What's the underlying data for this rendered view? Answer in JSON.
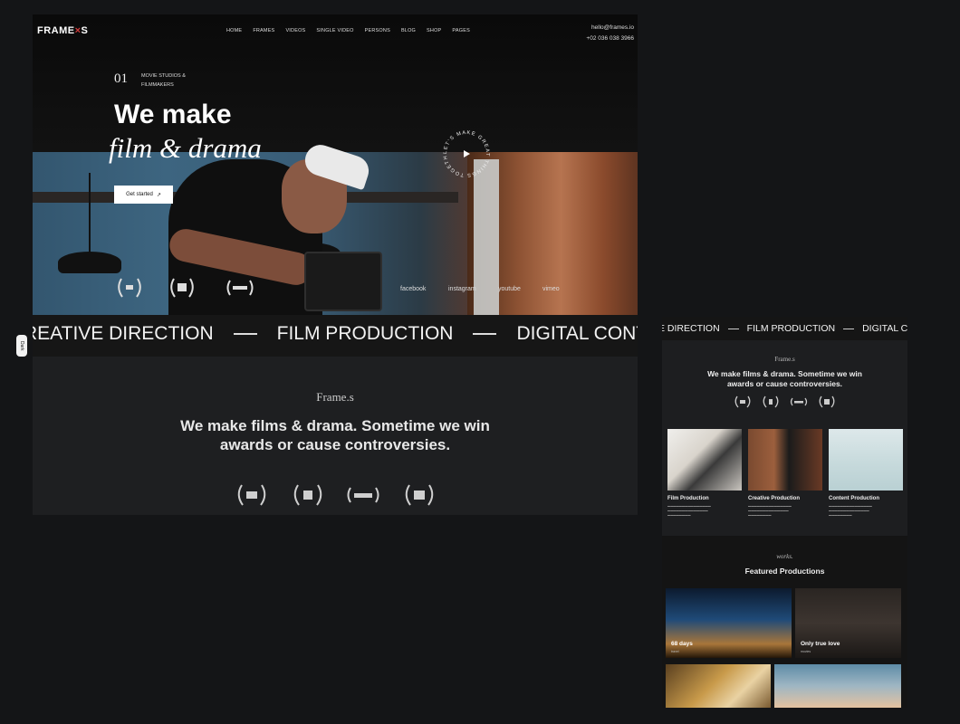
{
  "desktop": {
    "brand": {
      "name": "FRAME",
      "x_mark": "×",
      "suffix": "S"
    },
    "nav": [
      "HOME",
      "FRAMES",
      "VIDEOS",
      "SINGLE VIDEO",
      "PERSONS",
      "BLOG",
      "SHOP",
      "PAGES"
    ],
    "contact": {
      "email": "hello@frames.io",
      "phone": "+02 036 038 3966"
    },
    "hero": {
      "number": "01",
      "studios_label": "MOVIE STUDIOS & FILMMAKERS",
      "title_line1": "We make",
      "title_line2": "film & drama",
      "cta_label": "Get started",
      "cta_arrow": "↗",
      "circle_text": "LET'S MAKE GREAT THINGS TOGETHER"
    },
    "social": [
      "facebook",
      "instagram",
      "youtube",
      "vimeo"
    ],
    "marquee": [
      "REATIVE DIRECTION",
      "FILM PRODUCTION",
      "DIGITAL CONTENT"
    ],
    "side_tab": "Dark",
    "intro": {
      "brand": "Frame.s",
      "headline_line1": "We make films & drama. Sometime we win",
      "headline_line2": "awards or cause controversies."
    }
  },
  "mobile": {
    "marquee": [
      "E DIRECTION",
      "FILM PRODUCTION",
      "DIGITAL CONTI"
    ],
    "brand": "Frame.s",
    "headline_line1": "We make films & drama. Sometime we win",
    "headline_line2": "awards or cause controversies.",
    "services": [
      {
        "name": "Film Production"
      },
      {
        "name": "Creative Production"
      },
      {
        "name": "Content Production"
      }
    ],
    "works_label": "works.",
    "works_title": "Featured Productions",
    "works": [
      {
        "title": "68 days",
        "sub": "travel"
      },
      {
        "title": "Only true love",
        "sub": "movies"
      }
    ]
  },
  "colors": {
    "background": "#141517",
    "panel": "#1e1f21",
    "accent": "#d23b3b"
  }
}
